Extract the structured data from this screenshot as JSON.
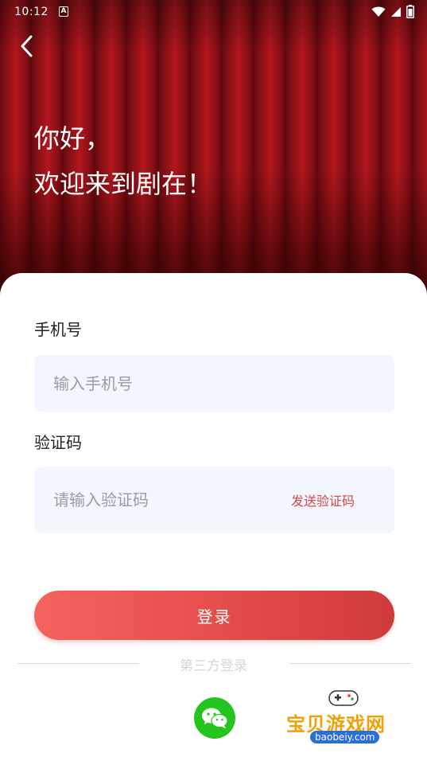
{
  "status_bar": {
    "time": "10:12"
  },
  "header": {
    "greeting_line1": "你好，",
    "greeting_line2": "欢迎来到剧在！"
  },
  "form": {
    "phone": {
      "label": "手机号",
      "placeholder": "输入手机号",
      "value": ""
    },
    "code": {
      "label": "验证码",
      "placeholder": "请输入验证码",
      "value": "",
      "send_label": "发送验证码"
    }
  },
  "login_button": {
    "label": "登录"
  },
  "third_party": {
    "label": "第三方登录",
    "providers": [
      "wechat"
    ]
  },
  "watermark": {
    "text": "宝贝游戏网",
    "url": "baobeiy.com"
  },
  "colors": {
    "accent": "#e24a48",
    "send_code": "#d4474b",
    "input_bg": "#f3f6fd",
    "wechat": "#25c51f"
  },
  "icons": [
    "back-arrow-icon",
    "wifi-icon",
    "signal-icon",
    "battery-icon",
    "wechat-icon"
  ]
}
